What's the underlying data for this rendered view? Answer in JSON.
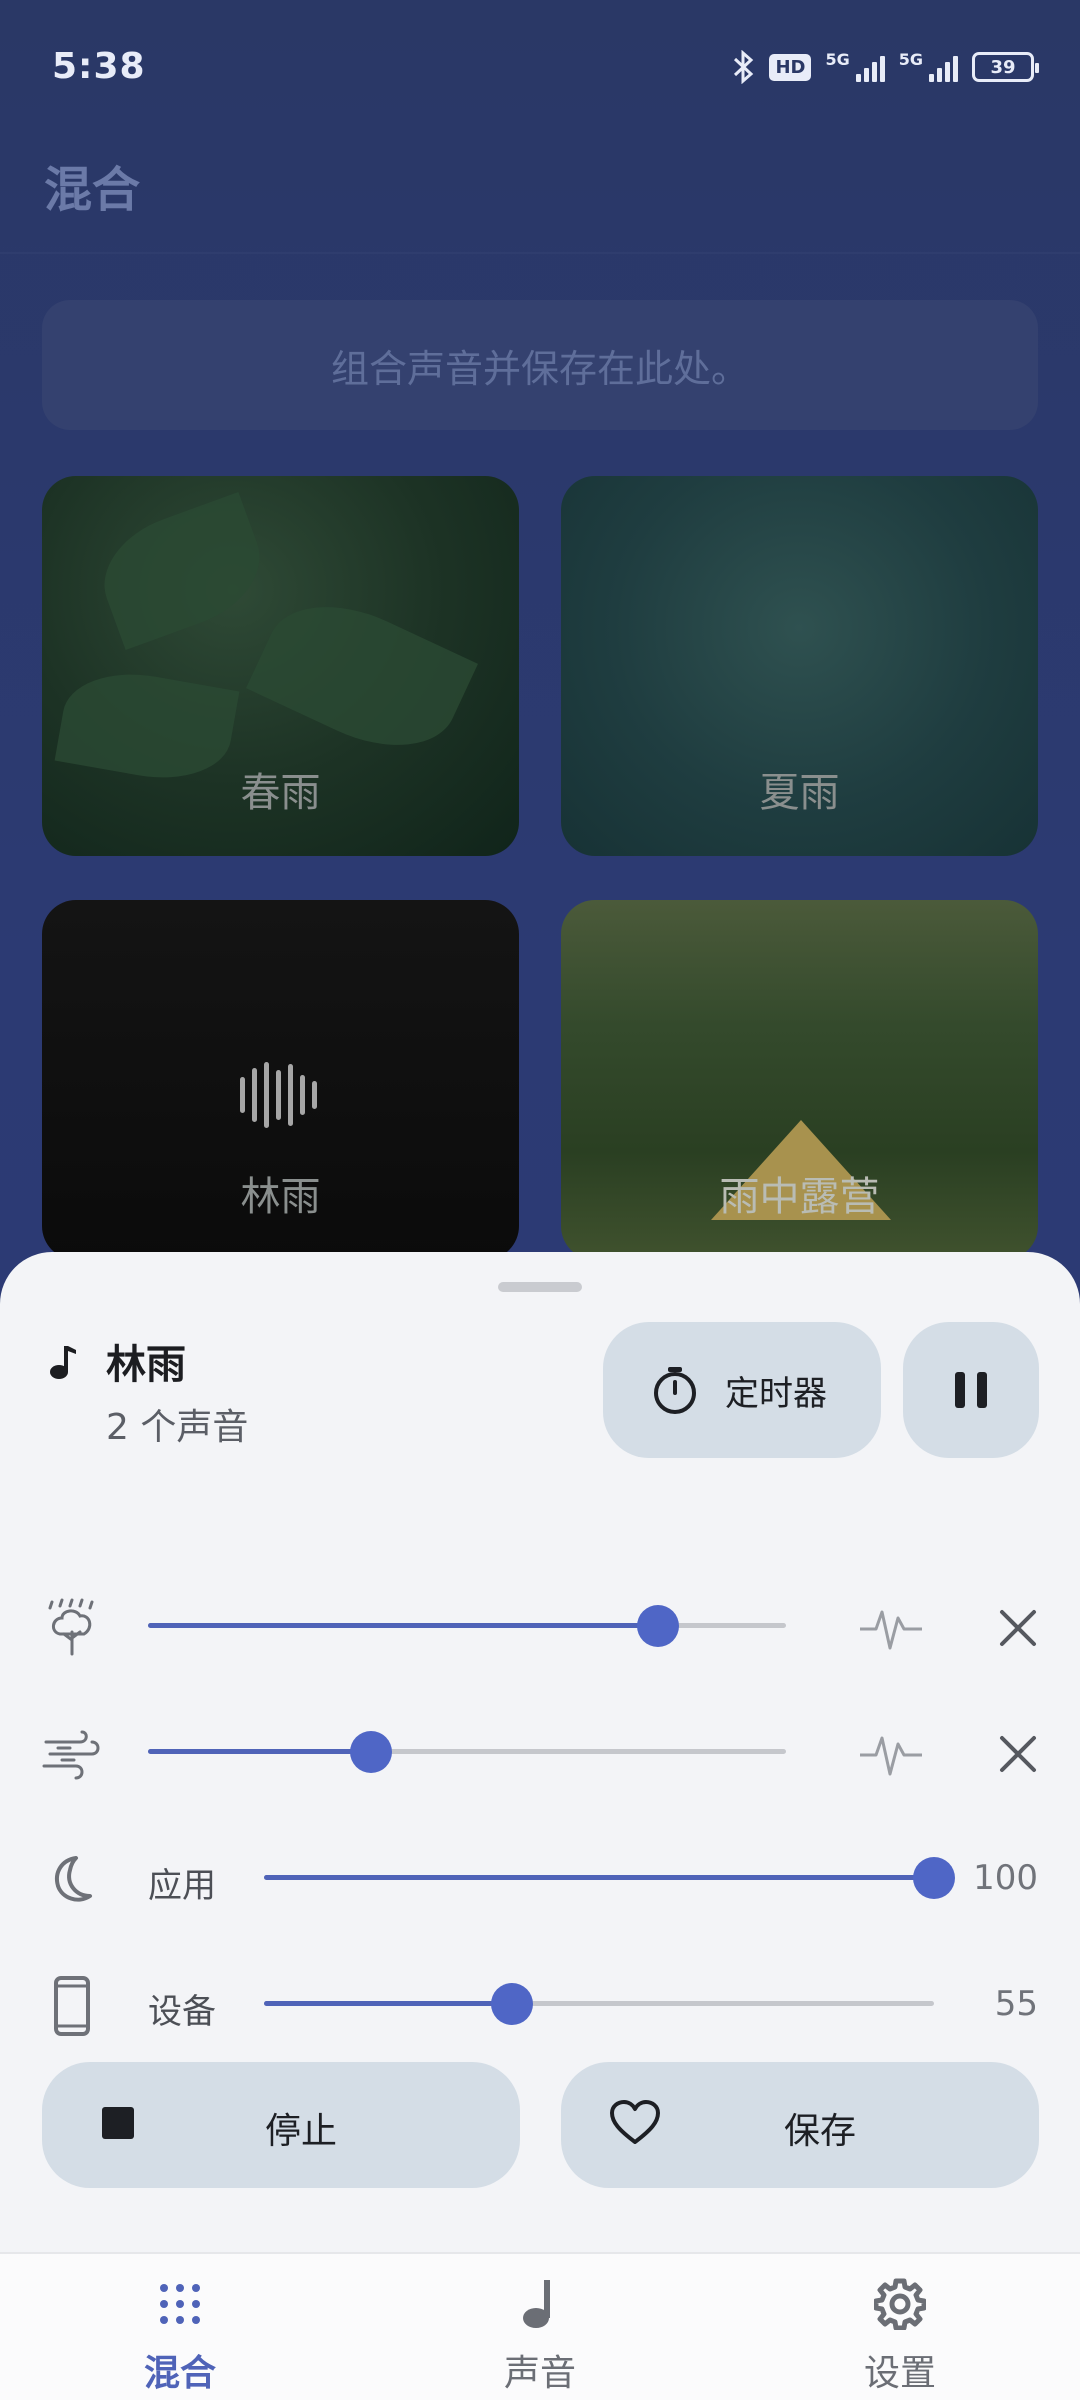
{
  "status_bar": {
    "time": "5:38",
    "hd": "HD",
    "net1": "5G",
    "net2": "5G",
    "battery": "39"
  },
  "header": {
    "title": "混合"
  },
  "hint": "组合声音并保存在此处。",
  "cards": [
    {
      "label": "春雨"
    },
    {
      "label": "夏雨"
    },
    {
      "label": "林雨"
    },
    {
      "label": "雨中露营"
    }
  ],
  "sheet": {
    "mix_name": "林雨",
    "mix_sub": "2 个声音",
    "timer_label": "定时器",
    "sound_sliders": [
      {
        "icon": "tree-rain-icon",
        "level": 0.8
      },
      {
        "icon": "wind-icon",
        "level": 0.35
      }
    ],
    "app_volume": {
      "label": "应用",
      "value": "100",
      "level": 1.0
    },
    "device_volume": {
      "label": "设备",
      "value": "55",
      "level": 0.37
    },
    "stop_label": "停止",
    "save_label": "保存"
  },
  "nav": {
    "items": [
      {
        "label": "混合",
        "icon": "grid-dots-icon",
        "active": true
      },
      {
        "label": "声音",
        "icon": "music-note-icon",
        "active": false
      },
      {
        "label": "设置",
        "icon": "gear-icon",
        "active": false
      }
    ]
  },
  "colors": {
    "accent": "#4f63b8",
    "sheet_bg": "#f3f4f7",
    "pill_bg": "#d4dde6"
  }
}
